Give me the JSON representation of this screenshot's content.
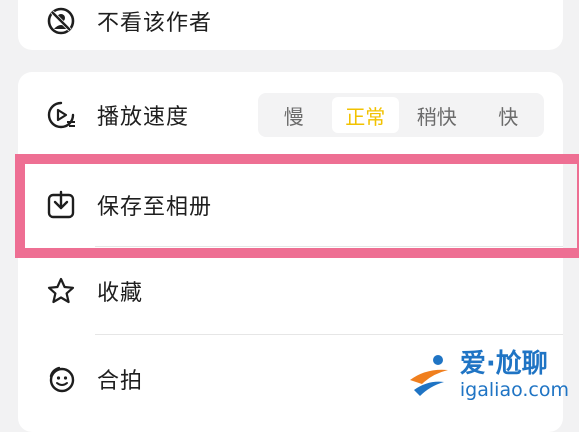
{
  "menu": {
    "block_author_label": "不看该作者",
    "playback_speed": {
      "label": "播放速度",
      "options": [
        "慢",
        "正常",
        "稍快",
        "快"
      ],
      "selected": "正常"
    },
    "save_to_album_label": "保存至相册",
    "favorite_label": "收藏",
    "duet_label": "合拍"
  },
  "colors": {
    "highlight_border": "#ee6f93",
    "speed_active": "#f2c200",
    "watermark": "#1f74c4"
  },
  "watermark": {
    "title": "爱·尬聊",
    "url": "igaliao.com"
  }
}
